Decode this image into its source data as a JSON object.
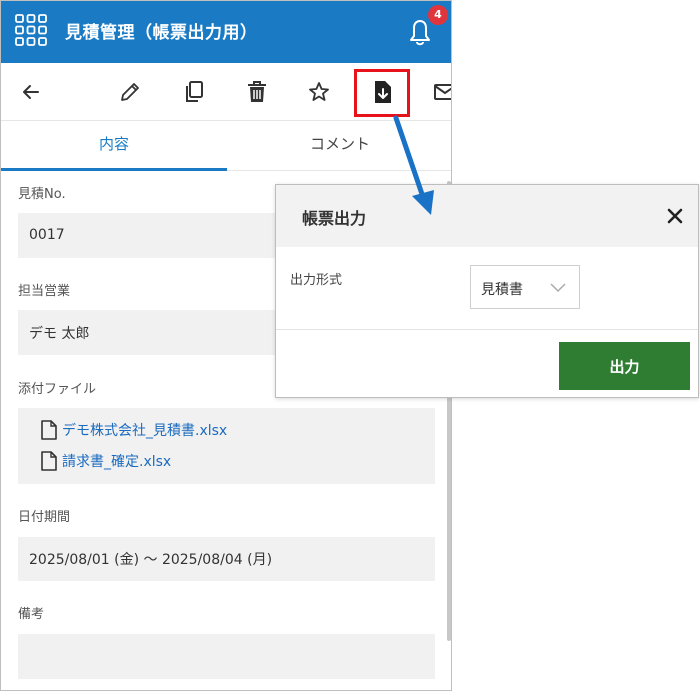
{
  "header": {
    "title": "見積管理（帳票出力用）",
    "notification_count": "4",
    "bg_color": "#1a7bc4"
  },
  "toolbar": {
    "icons": [
      "back-arrow-icon",
      "pencil-icon",
      "copy-icon",
      "trash-icon",
      "star-icon",
      "file-download-icon",
      "mail-icon"
    ],
    "highlight_color": "#e8131a"
  },
  "tabs": [
    {
      "label": "内容",
      "active": true
    },
    {
      "label": "コメント",
      "active": false
    }
  ],
  "fields": {
    "estimate_no": {
      "label": "見積No.",
      "value": "0017"
    },
    "sales_rep": {
      "label": "担当営業",
      "value": "デモ 太郎"
    },
    "attachments": {
      "label": "添付ファイル",
      "files": [
        "デモ株式会社_見積書.xlsx",
        "請求書_確定.xlsx"
      ]
    },
    "date_period": {
      "label": "日付期間",
      "value": "2025/08/01 (金) ～ 2025/08/04 (月)"
    },
    "notes": {
      "label": "備考",
      "value": ""
    }
  },
  "dialog": {
    "title": "帳票出力",
    "output_format_label": "出力形式",
    "output_format_value": "見積書",
    "submit_label": "出力",
    "submit_color": "#2e7d32"
  }
}
